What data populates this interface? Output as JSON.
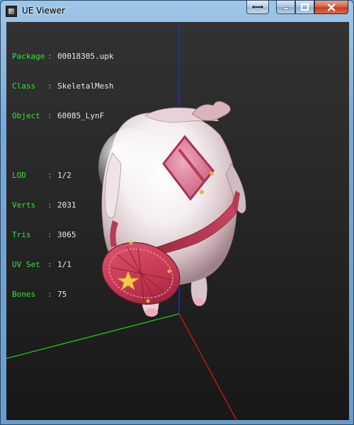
{
  "window": {
    "title": "UE Viewer",
    "restore_icon": "swap-arrows-icon",
    "minimize_icon": "minimize-icon",
    "maximize_icon": "maximize-icon",
    "close_icon": "close-icon"
  },
  "info": {
    "package_label": "Package",
    "package_value": "00018305.upk",
    "class_label": "Class",
    "class_value": "SkeletalMesh",
    "object_label": "Object",
    "object_value": "60085_LynF",
    "lod_label": "LOD",
    "lod_value": "1/2",
    "verts_label": "Verts",
    "verts_value": "2031",
    "tris_label": "Tris",
    "tris_value": "3065",
    "uvset_label": "UV Set",
    "uvset_value": "1/1",
    "bones_label": "Bones",
    "bones_value": "75",
    "separator": ":"
  },
  "colors": {
    "label_green": "#35e13a",
    "value_white": "#e8e8e8",
    "axis_x": "#d01818",
    "axis_y": "#1aca1a",
    "axis_z": "#1a2fd6",
    "viewport_bg": "#262626"
  }
}
